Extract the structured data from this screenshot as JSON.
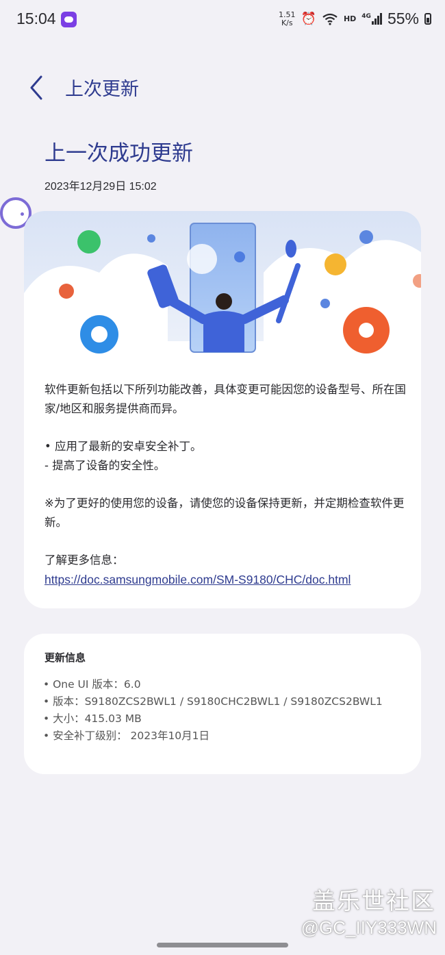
{
  "status_bar": {
    "time": "15:04",
    "net_speed_value": "1.51",
    "net_speed_unit": "K/s",
    "hd_label": "HD",
    "network_label": "4G",
    "battery": "55%"
  },
  "header": {
    "title": "上次更新"
  },
  "main": {
    "headline": "上一次成功更新",
    "date": "2023年12月29日 15:02",
    "description": "软件更新包括以下所列功能改善，具体变更可能因您的设备型号、所在国家/地区和服务提供商而异。",
    "bullet1": "• 应用了最新的安卓安全补丁。",
    "bullet1_sub": " - 提高了设备的安全性。",
    "note": "※为了更好的使用您的设备，请使您的设备保持更新，并定期检查软件更新。",
    "more_label": "了解更多信息：",
    "more_link": "https://doc.samsungmobile.com/SM-S9180/CHC/doc.html"
  },
  "update_info": {
    "title": "更新信息",
    "items": [
      "• One UI 版本：6.0",
      "• 版本：S9180ZCS2BWL1 / S9180CHC2BWL1 / S9180ZCS2BWL1",
      "• 大小：415.03 MB",
      "• 安全补丁级别： 2023年10月1日"
    ]
  },
  "watermark": {
    "site": "盖乐世社区",
    "user": "@GC_IIY333WN"
  },
  "colors": {
    "accent": "#2e3b8f",
    "background": "#f2f1f6",
    "card": "#ffffff"
  }
}
